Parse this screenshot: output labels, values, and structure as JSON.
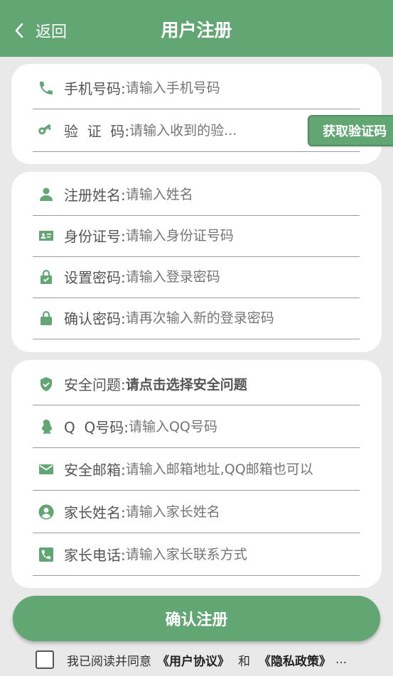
{
  "header": {
    "back_label": "返回",
    "title": "用户注册",
    "background": "#62a674"
  },
  "card1": {
    "phone": {
      "icon": "phone-icon",
      "label": "手机号码:",
      "placeholder": "请输入手机号码"
    },
    "code": {
      "icon": "key-icon",
      "label": "验  证  码:",
      "placeholder": "请输入收到的验...",
      "button": "获取验证码"
    }
  },
  "card2": {
    "name": {
      "icon": "person-icon",
      "label": "注册姓名:",
      "placeholder": "请输入姓名"
    },
    "idcard": {
      "icon": "id-card-icon",
      "label": "身份证号:",
      "placeholder": "请输入身份证号码"
    },
    "password": {
      "icon": "lock-check-icon",
      "label": "设置密码:",
      "placeholder": "请输入登录密码"
    },
    "confirm": {
      "icon": "lock-icon",
      "label": "确认密码:",
      "placeholder": "请再次输入新的登录密码"
    }
  },
  "card3": {
    "question": {
      "icon": "shield-check-icon",
      "label": "安全问题:",
      "value": "请点击选择安全问题"
    },
    "qq": {
      "icon": "penguin-icon",
      "label": "Q  Q号码:",
      "placeholder": "请输入QQ号码"
    },
    "email": {
      "icon": "mail-icon",
      "label": "安全邮箱:",
      "placeholder": "请输入邮箱地址,QQ邮箱也可以"
    },
    "parent_name": {
      "icon": "person-circle-icon",
      "label": "家长姓名:",
      "placeholder": "请输入家长姓名"
    },
    "parent_phone": {
      "icon": "phone-square-icon",
      "label": "家长电话:",
      "placeholder": "请输入家长联系方式"
    }
  },
  "submit_label": "确认注册",
  "agreement": {
    "prefix": "我已阅读并同意",
    "user_agreement": "《用户协议》",
    "and": "和",
    "privacy_policy": "《隐私政策》",
    "ellipsis": "..."
  }
}
